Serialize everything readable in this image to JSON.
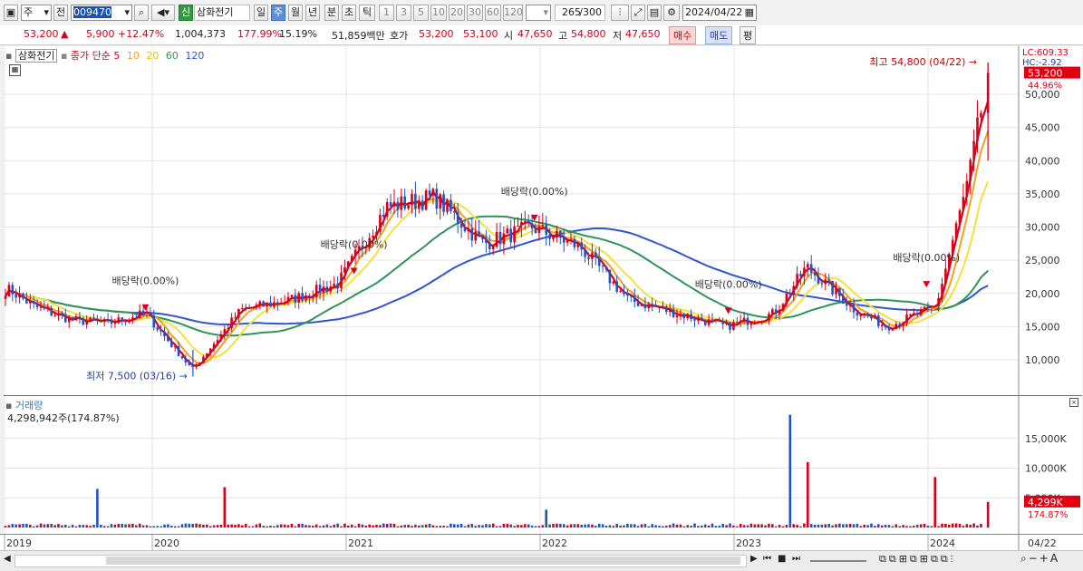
{
  "toolbar": {
    "type_label": "주",
    "prev_label": "전",
    "code_value": "009470",
    "stock_badge": "신",
    "stock_name": "삼화전기",
    "periods": [
      "일",
      "주",
      "월",
      "년",
      "분",
      "초",
      "틱"
    ],
    "active_period": "주",
    "interval_values": [
      "1",
      "3",
      "5",
      "10",
      "20",
      "30",
      "60",
      "120"
    ],
    "count_value": "265",
    "count_total": "/300",
    "date_value": "2024/04/22"
  },
  "quote": {
    "price": "53,200",
    "change_arrow": "▲",
    "change": "5,900",
    "change_pct": "+12.47%",
    "volume": "1,004,373",
    "volume_ratio": "177.99%",
    "turnover": "15.19%",
    "trade_value": "51,859백만",
    "ask_label": "호가",
    "ask": "53,200",
    "bid": "53,100",
    "open_label": "시",
    "open": "47,650",
    "high_label": "고",
    "high": "54,800",
    "low_label": "저",
    "low": "47,650",
    "buy_button": "매수",
    "sell_button": "매도",
    "eval_button": "평"
  },
  "price_panel": {
    "title": "삼화전기",
    "ma_label": "종가 단순",
    "ma_periods": [
      "5",
      "10",
      "20",
      "60",
      "120"
    ],
    "ma_colors": [
      "#d9001b",
      "#f2a11c",
      "#f5e13a",
      "#2f9456",
      "#2f55d4"
    ],
    "lc_label": "LC:609.33",
    "hc_label": "HC:-2.92",
    "current_tag": "53,200",
    "current_pct": "44.96%",
    "high_annotation": "최고 54,800 (04/22)",
    "low_annotation": "최저 7,500 (03/16)",
    "dividend_label": "배당락(0.00%)",
    "dividend_labels": [
      "배당락(0.00%)",
      "배당락(0.00%)",
      "배당락(0.00%)",
      "배당락(0.00%)",
      "배당락(0.00%)"
    ],
    "y_ticks": [
      "50,000",
      "45,000",
      "40,000",
      "35,000",
      "30,000",
      "25,000",
      "20,000",
      "15,000",
      "10,000"
    ]
  },
  "volume_panel": {
    "title": "거래량",
    "value_label": "4,298,942주(174.87%)",
    "current_tag": "4,299K",
    "current_pct": "174.87%",
    "y_ticks": [
      "15,000K",
      "10,000K",
      "5,000K"
    ]
  },
  "x_axis": {
    "labels": [
      "2019",
      "2020",
      "2021",
      "2022",
      "2023",
      "2024"
    ],
    "end_label": "04/22"
  },
  "chart_data": [
    {
      "type": "candlestick",
      "title": "삼화전기",
      "x_range": [
        "2019-01",
        "2024-04-22"
      ],
      "y_range": [
        5000,
        57000
      ],
      "bull_color": "#d9001b",
      "bear_color": "#1f53c6",
      "approx_weekly_close": [
        {
          "date": "2019-01",
          "close": 20500
        },
        {
          "date": "2019-03",
          "close": 18000
        },
        {
          "date": "2019-06",
          "close": 16000
        },
        {
          "date": "2019-09",
          "close": 15500
        },
        {
          "date": "2019-12",
          "close": 17000
        },
        {
          "date": "2020-03",
          "close": 8500
        },
        {
          "date": "2020-06",
          "close": 17500
        },
        {
          "date": "2020-09",
          "close": 19000
        },
        {
          "date": "2020-12",
          "close": 21500
        },
        {
          "date": "2021-03",
          "close": 33000
        },
        {
          "date": "2021-06",
          "close": 34500
        },
        {
          "date": "2021-09",
          "close": 27500
        },
        {
          "date": "2021-12",
          "close": 30000
        },
        {
          "date": "2022-03",
          "close": 27000
        },
        {
          "date": "2022-06",
          "close": 19000
        },
        {
          "date": "2022-09",
          "close": 17000
        },
        {
          "date": "2022-12",
          "close": 15000
        },
        {
          "date": "2023-03",
          "close": 17000
        },
        {
          "date": "2023-05",
          "close": 24000
        },
        {
          "date": "2023-08",
          "close": 17500
        },
        {
          "date": "2023-10",
          "close": 15000
        },
        {
          "date": "2024-01",
          "close": 18000
        },
        {
          "date": "2024-03",
          "close": 37000
        },
        {
          "date": "2024-04-22",
          "close": 53200
        }
      ],
      "high": {
        "value": 54800,
        "date": "04/22"
      },
      "low": {
        "value": 7500,
        "date": "03/16"
      }
    },
    {
      "type": "bar",
      "title": "거래량",
      "y_range": [
        0,
        20000
      ],
      "unit": "K",
      "spikes": [
        {
          "date": "2019-08",
          "value": 6500
        },
        {
          "date": "2020-05",
          "value": 6800
        },
        {
          "date": "2022-01",
          "value": 3000
        },
        {
          "date": "2023-04",
          "value": 19000
        },
        {
          "date": "2023-05",
          "value": 11000
        },
        {
          "date": "2024-01",
          "value": 8500
        },
        {
          "date": "2024-04-22",
          "value": 4299
        }
      ]
    }
  ]
}
